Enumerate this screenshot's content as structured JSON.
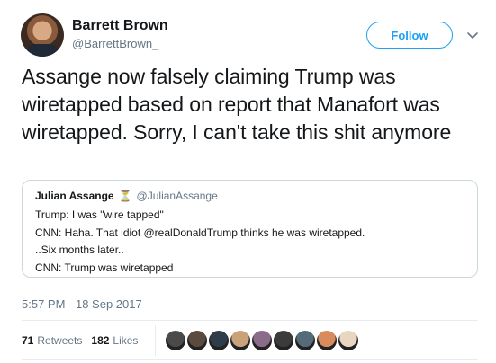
{
  "author": {
    "name": "Barrett Brown",
    "handle": "@BarrettBrown_"
  },
  "follow_label": "Follow",
  "tweet_text": "Assange now falsely claiming Trump was wiretapped based on report that Manafort was wiretapped. Sorry, I can't take this shit anymore",
  "quoted": {
    "name": "Julian Assange",
    "badge": "⏳",
    "handle": "@JulianAssange",
    "lines": [
      "Trump: I was \"wire tapped\"",
      "CNN: Haha. That idiot @realDonaldTrump thinks he was wiretapped.",
      "..Six months later..",
      "CNN: Trump was wiretapped"
    ]
  },
  "timestamp": "5:57 PM - 18 Sep 2017",
  "stats": {
    "retweets_count": "71",
    "retweets_label": "Retweets",
    "likes_count": "182",
    "likes_label": "Likes"
  },
  "colors": {
    "accent": "#1da1f2",
    "secondary_text": "#657786",
    "border": "#ccd6dd"
  },
  "icons": {
    "more": "chevron-down-icon",
    "verified_badge": "hourglass-icon"
  },
  "likers": [
    {
      "color": "#4a4a4a"
    },
    {
      "color": "#5b4a3e"
    },
    {
      "color": "#2f3c4a"
    },
    {
      "color": "#c9a27a"
    },
    {
      "color": "#8a6b8a"
    },
    {
      "color": "#3b3b3b"
    },
    {
      "color": "#556b7a"
    },
    {
      "color": "#d98b5e"
    },
    {
      "color": "#e8d6c0"
    }
  ]
}
